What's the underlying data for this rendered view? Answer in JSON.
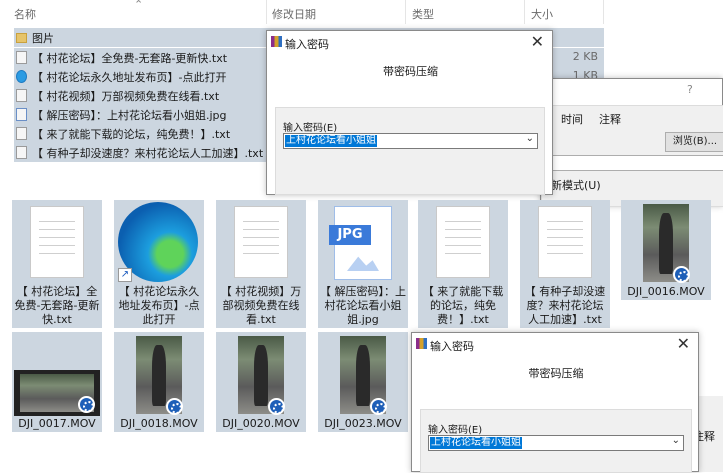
{
  "header": {
    "name": "名称",
    "date": "修改日期",
    "type": "类型",
    "size": "大小"
  },
  "list": [
    {
      "name": "图片",
      "size": ""
    },
    {
      "name": "【 村花论坛】全免费-无套路-更新快.txt",
      "size": "2 KB"
    },
    {
      "name": "【 村花论坛永久地址发布页】-点此打开",
      "size": "1 KB"
    },
    {
      "name": "【 村花视频】万部视频免费在线看.txt",
      "size": ""
    },
    {
      "name": "【 解压密码】：上村花论坛看小姐姐.jpg",
      "size": ""
    },
    {
      "name": "【 来了就能下载的论坛，纯免费！】.txt",
      "size": ""
    },
    {
      "name": "【 有种子却没速度？来村花论坛人工加速】.txt",
      "size": ""
    }
  ],
  "tiles": [
    "【 村花论坛】全免费-无套路-更新快.txt",
    "【 村花论坛永久地址发布页】-点此打开",
    "【 村花视频】万部视频免费在线看.txt",
    "【 解压密码】：上村花论坛看小姐姐.jpg",
    "【 来了就能下载的论坛，纯免费！】.txt",
    "【 有种子却没速度？来村花论坛人工加速】.txt",
    "DJI_0016.MOV",
    "DJI_0017.MOV",
    "DJI_0018.MOV",
    "DJI_0020.MOV",
    "DJI_0023.MOV"
  ],
  "jpg_label": "JPG",
  "dialog1": {
    "title": "输入密码",
    "close": "✕",
    "heading": "带密码压缩",
    "label": "输入密码(E)",
    "value": "上村花论坛看小姐姐",
    "dropdown": "⌄"
  },
  "dialog2": {
    "title": "输入密码",
    "close": "✕",
    "heading": "带密码压缩",
    "label": "输入密码(E)",
    "value": "上村花论坛看小姐姐",
    "dropdown": "⌄"
  },
  "backdialog": {
    "question": "?",
    "tab_time": "时间",
    "tab_comment": "注释",
    "browse": "浏览(B)...",
    "mode": "新模式(U)",
    "tab_comment2": "注释"
  }
}
